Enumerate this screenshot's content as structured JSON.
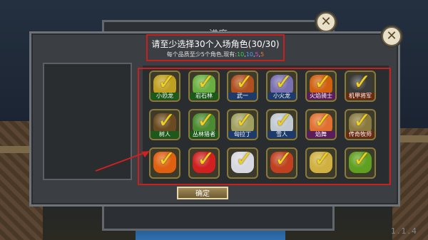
{
  "background": {
    "version": "1.1.4"
  },
  "back_panel": {
    "title": "进度"
  },
  "dialog": {
    "title": "请至少选择30个入场角色(30/30)",
    "subtitle_prefix": "每个品质至少5个角色,现有:",
    "quality_counts": [
      {
        "value": "10",
        "color": "#34d05a"
      },
      {
        "value": "10",
        "color": "#4aa0ff"
      },
      {
        "value": "5",
        "color": "#e04adf"
      },
      {
        "value": "5",
        "color": "#f07a30"
      }
    ],
    "separator": ",",
    "confirm_label": "确定"
  },
  "characters": [
    {
      "name": "小恐龙",
      "label_color": "#1c5a1c",
      "face": "#c0a020",
      "checked": true
    },
    {
      "name": "岩石林",
      "label_color": "#1c5a1c",
      "face": "#6ab040",
      "checked": true
    },
    {
      "name": "武一",
      "label_color": "#1c3a6a",
      "face": "#b05020",
      "checked": true
    },
    {
      "name": "小火龙",
      "label_color": "#1c3a6a",
      "face": "#7a70b0",
      "checked": true
    },
    {
      "name": "火焰骑士",
      "label_color": "#5a1c5a",
      "face": "#d06010",
      "checked": true
    },
    {
      "name": "机甲将军",
      "label_color": "#6a2a10",
      "face": "#3a3a3a",
      "checked": true
    },
    {
      "name": "树人",
      "label_color": "#1c5a1c",
      "face": "#6a4a20",
      "checked": true
    },
    {
      "name": "丛林猎者",
      "label_color": "#1c5a1c",
      "face": "#4a8a30",
      "checked": true
    },
    {
      "name": "匈拉丁",
      "label_color": "#1c3a6a",
      "face": "#a0a060",
      "checked": true
    },
    {
      "name": "雪人",
      "label_color": "#1c3a6a",
      "face": "#c0c8d0",
      "checked": true
    },
    {
      "name": "焰舞",
      "label_color": "#5a1c5a",
      "face": "#e07030",
      "checked": true
    },
    {
      "name": "传奇牧师",
      "label_color": "#6a2a10",
      "face": "#8a7a40",
      "checked": true
    },
    {
      "name": "",
      "label_color": "",
      "face": "#e06010",
      "checked": true
    },
    {
      "name": "",
      "label_color": "",
      "face": "#d02020",
      "checked": true
    },
    {
      "name": "",
      "label_color": "",
      "face": "#d8d8e0",
      "checked": true
    },
    {
      "name": "",
      "label_color": "",
      "face": "#c04020",
      "checked": true
    },
    {
      "name": "",
      "label_color": "",
      "face": "#d0b040",
      "checked": true
    },
    {
      "name": "",
      "label_color": "",
      "face": "#60a020",
      "checked": true
    }
  ],
  "colors": {
    "highlight_box": "#c8201c",
    "check": "#f0d020"
  }
}
